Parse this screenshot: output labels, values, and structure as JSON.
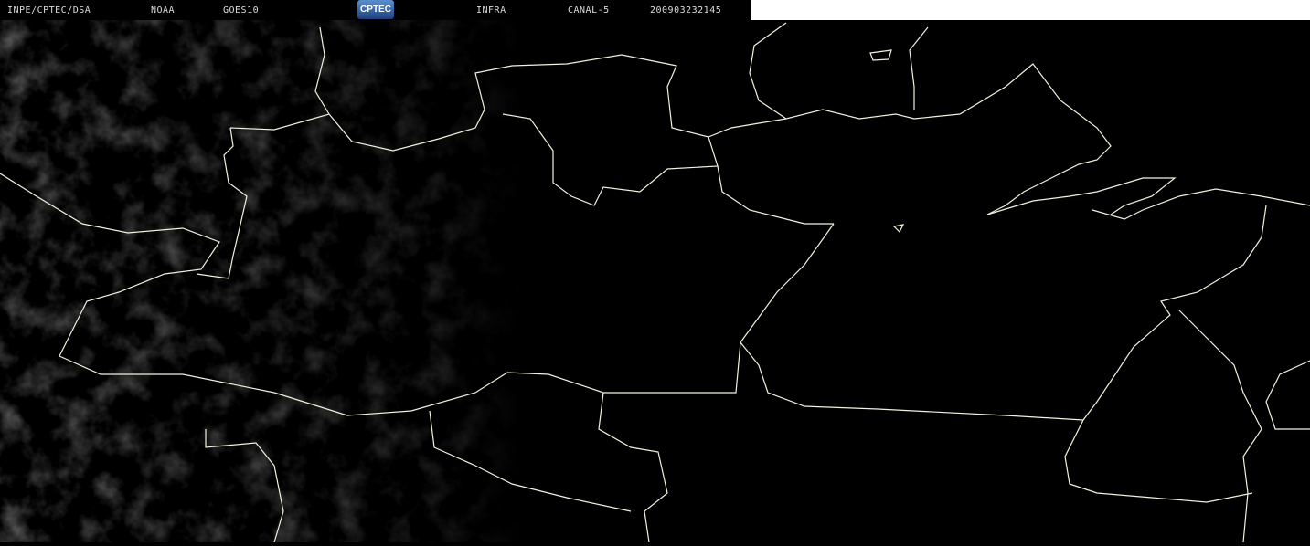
{
  "header": {
    "source": "INPE/CPTEC/DSA",
    "agency": "NOAA",
    "satellite": "GOES10",
    "logo_text": "CPTEC",
    "product": "INFRA",
    "channel": "CANAL-5",
    "timestamp": "200903232145"
  }
}
